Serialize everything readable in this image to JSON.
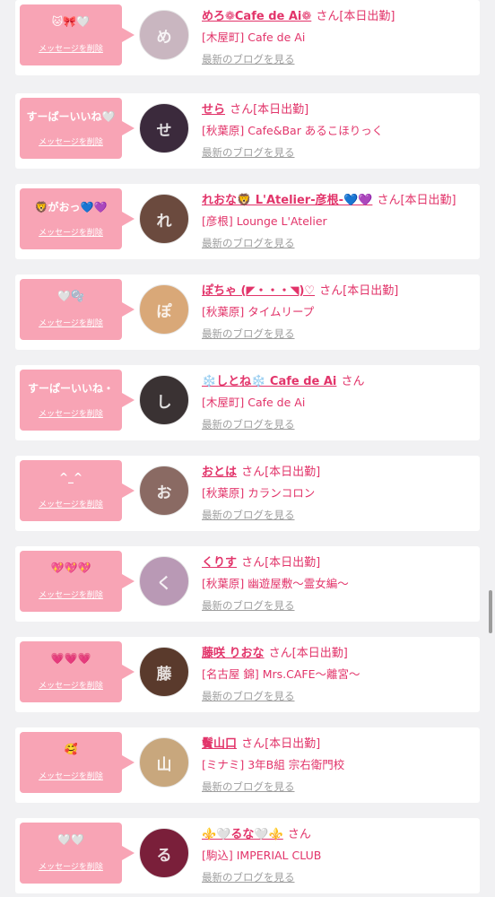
{
  "cards": [
    {
      "message": "🐱🎀🤍",
      "delete_label": "メッセージを削除",
      "name": "めろ❁Cafe de Ai❁",
      "suffix": "さん[本日出勤]",
      "shop": "[木屋町] Cafe de Ai",
      "blog_label": "最新のブログを見る",
      "avatar_initial": "め",
      "avatar_color": "#c9b6c0"
    },
    {
      "message": "すーぱーいいね🤍",
      "delete_label": "メッセージを削除",
      "name": "せら",
      "suffix": "さん[本日出勤]",
      "shop": "[秋葉原] Cafe&Bar あるこほりっく",
      "blog_label": "最新のブログを見る",
      "avatar_initial": "せ",
      "avatar_color": "#3b2a3c"
    },
    {
      "message": "🦁がおっ💙💜",
      "delete_label": "メッセージを削除",
      "name": "れおな🦁 L'Atelier-彦根-💙💜",
      "suffix": "さん[本日出勤]",
      "shop": "[彦根] Lounge L'Atelier",
      "blog_label": "最新のブログを見る",
      "avatar_initial": "れ",
      "avatar_color": "#6b4a3e"
    },
    {
      "message": "🤍🫧",
      "delete_label": "メッセージを削除",
      "name": "ぽちゃ (◤・・・◥)♡",
      "suffix": "さん[本日出勤]",
      "shop": "[秋葉原] タイムリープ",
      "blog_label": "最新のブログを見る",
      "avatar_initial": "ぽ",
      "avatar_color": "#d9a878"
    },
    {
      "message": "すーぱーいいね・",
      "delete_label": "メッセージを削除",
      "name": "❄️しとね❄️ Cafe de Ai",
      "suffix": "さん",
      "shop": "[木屋町] Cafe de Ai",
      "blog_label": "最新のブログを見る",
      "avatar_initial": "し",
      "avatar_color": "#3a3233"
    },
    {
      "message": "^_^",
      "delete_label": "メッセージを削除",
      "name": "おとは",
      "suffix": "さん[本日出勤]",
      "shop": "[秋葉原] カランコロン",
      "blog_label": "最新のブログを見る",
      "avatar_initial": "お",
      "avatar_color": "#8a6a63"
    },
    {
      "message": "💖💖💖",
      "delete_label": "メッセージを削除",
      "name": "くりす",
      "suffix": "さん[本日出勤]",
      "shop": "[秋葉原] 幽遊屋敷〜霊女編〜",
      "blog_label": "最新のブログを見る",
      "avatar_initial": "く",
      "avatar_color": "#b999b5"
    },
    {
      "message": "💗💗💗",
      "delete_label": "メッセージを削除",
      "name": "藤咲 りおな",
      "suffix": "さん[本日出勤]",
      "shop": "[名古屋 錦] Mrs.CAFE〜離宮〜",
      "blog_label": "最新のブログを見る",
      "avatar_initial": "藤",
      "avatar_color": "#5a3a2c"
    },
    {
      "message": "🥰",
      "delete_label": "メッセージを削除",
      "name": "鬢山口",
      "suffix": "さん[本日出勤]",
      "shop": "[ミナミ] 3年B組 宗右衛門校",
      "blog_label": "最新のブログを見る",
      "avatar_initial": "山",
      "avatar_color": "#c8a77d"
    },
    {
      "message": "🤍🤍",
      "delete_label": "メッセージを削除",
      "name": "⚜️🤍るな🤍⚜️",
      "suffix": "さん",
      "shop": "[駒込] IMPERIAL CLUB",
      "blog_label": "最新のブログを見る",
      "avatar_initial": "る",
      "avatar_color": "#7a1f3a"
    }
  ]
}
